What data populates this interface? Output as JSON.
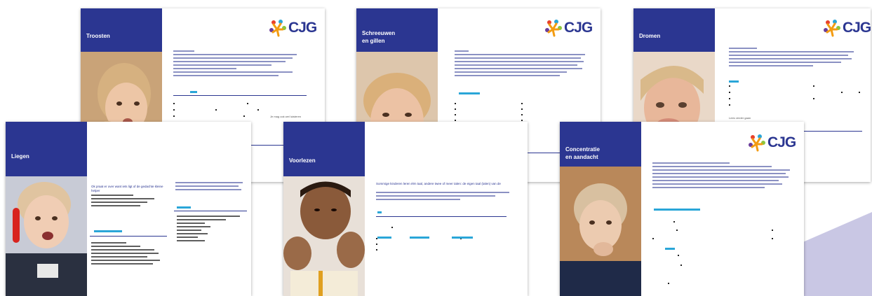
{
  "logo": {
    "text": "CJG"
  },
  "sheets": {
    "top_left": {
      "title": "Troosten"
    },
    "top_middle": {
      "title": "Schreeuwen\nen gillen"
    },
    "top_right": {
      "title": "Dromen"
    },
    "bottom_left": {
      "title": "Liegen"
    },
    "bottom_middle": {
      "title": "Voorlezen"
    },
    "bottom_right": {
      "title": "Concentratie\nen aandacht"
    }
  },
  "snippets": {
    "bottom_middle_intro": "Sommige kinderen leren één taal, andere twee of meer talen: de eigen taal (talen) van de",
    "bottom_left_intro": "Ok praat er over want iets ligt of de gedachte kleine helper",
    "top_left_note": "Je mag ook wel luisteren",
    "top_right_note": "Lees verder gaan"
  },
  "colors": {
    "brand_blue": "#2b3691",
    "accent_cyan": "#2aa6d8",
    "deco_lilac": "#c9c7e4"
  }
}
